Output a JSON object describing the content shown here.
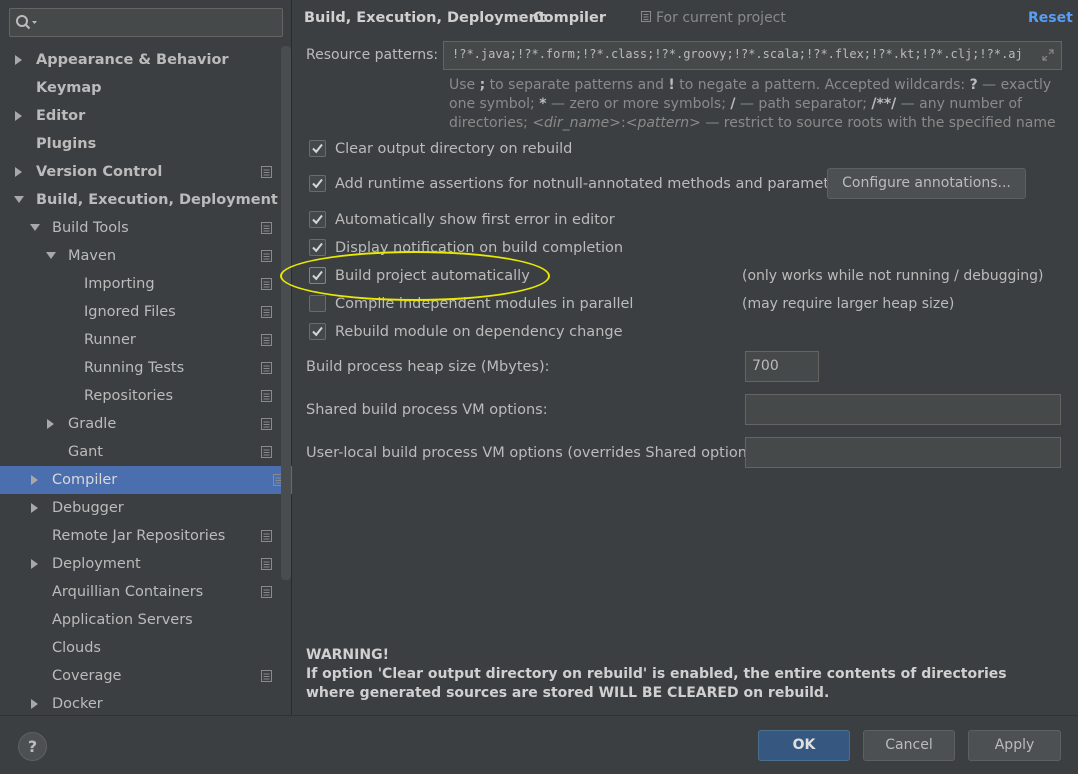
{
  "search": {
    "placeholder": ""
  },
  "tree": [
    {
      "label": "Appearance & Behavior",
      "level": 0,
      "arrow": "right",
      "bold": true,
      "proj": false
    },
    {
      "label": "Keymap",
      "level": 0,
      "arrow": "none",
      "bold": true,
      "proj": false
    },
    {
      "label": "Editor",
      "level": 0,
      "arrow": "right",
      "bold": true,
      "proj": false
    },
    {
      "label": "Plugins",
      "level": 0,
      "arrow": "none",
      "bold": true,
      "proj": false
    },
    {
      "label": "Version Control",
      "level": 0,
      "arrow": "right",
      "bold": true,
      "proj": true
    },
    {
      "label": "Build, Execution, Deployment",
      "level": 0,
      "arrow": "down",
      "bold": true,
      "proj": false
    },
    {
      "label": "Build Tools",
      "level": 1,
      "arrow": "down",
      "bold": false,
      "proj": true
    },
    {
      "label": "Maven",
      "level": 2,
      "arrow": "down",
      "bold": false,
      "proj": true
    },
    {
      "label": "Importing",
      "level": 3,
      "arrow": "none",
      "bold": false,
      "proj": true
    },
    {
      "label": "Ignored Files",
      "level": 3,
      "arrow": "none",
      "bold": false,
      "proj": true
    },
    {
      "label": "Runner",
      "level": 3,
      "arrow": "none",
      "bold": false,
      "proj": true
    },
    {
      "label": "Running Tests",
      "level": 3,
      "arrow": "none",
      "bold": false,
      "proj": true
    },
    {
      "label": "Repositories",
      "level": 3,
      "arrow": "none",
      "bold": false,
      "proj": true
    },
    {
      "label": "Gradle",
      "level": 2,
      "arrow": "right",
      "bold": false,
      "proj": true
    },
    {
      "label": "Gant",
      "level": 2,
      "arrow": "none",
      "bold": false,
      "proj": true
    },
    {
      "label": "Compiler",
      "level": 1,
      "arrow": "right",
      "bold": false,
      "proj": true,
      "selected": true
    },
    {
      "label": "Debugger",
      "level": 1,
      "arrow": "right",
      "bold": false,
      "proj": false
    },
    {
      "label": "Remote Jar Repositories",
      "level": 1,
      "arrow": "none",
      "bold": false,
      "proj": true
    },
    {
      "label": "Deployment",
      "level": 1,
      "arrow": "right",
      "bold": false,
      "proj": true
    },
    {
      "label": "Arquillian Containers",
      "level": 1,
      "arrow": "none",
      "bold": false,
      "proj": true
    },
    {
      "label": "Application Servers",
      "level": 1,
      "arrow": "none",
      "bold": false,
      "proj": false
    },
    {
      "label": "Clouds",
      "level": 1,
      "arrow": "none",
      "bold": false,
      "proj": false
    },
    {
      "label": "Coverage",
      "level": 1,
      "arrow": "none",
      "bold": false,
      "proj": true
    },
    {
      "label": "Docker",
      "level": 1,
      "arrow": "right",
      "bold": false,
      "proj": false
    }
  ],
  "header": {
    "crumb_parent": "Build, Execution, Deployment",
    "crumb_sep": "›",
    "crumb_current": "Compiler",
    "for_project": "For current project",
    "reset": "Reset"
  },
  "resource": {
    "label": "Resource patterns:",
    "value": "!?*.java;!?*.form;!?*.class;!?*.groovy;!?*.scala;!?*.flex;!?*.kt;!?*.clj;!?*.aj",
    "hint_html": "Use <b>;</b> to separate patterns and <b>!</b> to negate a pattern. Accepted wildcards: <b>?</b> — exactly one symbol; <b>*</b> — zero or more symbols; <b>/</b> — path separator; <b>/**/</b> — any number of directories; <i>&lt;dir_name&gt;</i>:<i>&lt;pattern&gt;</i> — restrict to source roots with the specified name"
  },
  "checkboxes": {
    "clear_output": {
      "label": "Clear output directory on rebuild",
      "checked": true
    },
    "runtime_assertions": {
      "label": "Add runtime assertions for notnull-annotated methods and parameters",
      "checked": true
    },
    "show_first_error": {
      "label": "Automatically show first error in editor",
      "checked": true
    },
    "display_notification": {
      "label": "Display notification on build completion",
      "checked": true
    },
    "build_auto": {
      "label": "Build project automatically",
      "checked": true
    },
    "compile_parallel": {
      "label": "Compile independent modules in parallel",
      "checked": false
    },
    "rebuild_module": {
      "label": "Rebuild module on dependency change",
      "checked": true
    }
  },
  "notes": {
    "build_auto": "(only works while not running / debugging)",
    "compile_parallel": "(may require larger heap size)"
  },
  "configure_annotations": "Configure annotations...",
  "heap": {
    "label": "Build process heap size (Mbytes):",
    "value": "700"
  },
  "shared_vm": {
    "label": "Shared build process VM options:",
    "value": ""
  },
  "user_vm": {
    "label": "User-local build process VM options (overrides Shared options):",
    "value": ""
  },
  "warning": {
    "title": "WARNING!",
    "body": "If option 'Clear output directory on rebuild' is enabled, the entire contents of directories where generated sources are stored WILL BE CLEARED on rebuild."
  },
  "buttons": {
    "help": "?",
    "ok": "OK",
    "cancel": "Cancel",
    "apply": "Apply"
  },
  "colors": {
    "accent": "#589df6",
    "selection": "#4b6eaf",
    "highlight_ellipse": "#e8e800"
  }
}
